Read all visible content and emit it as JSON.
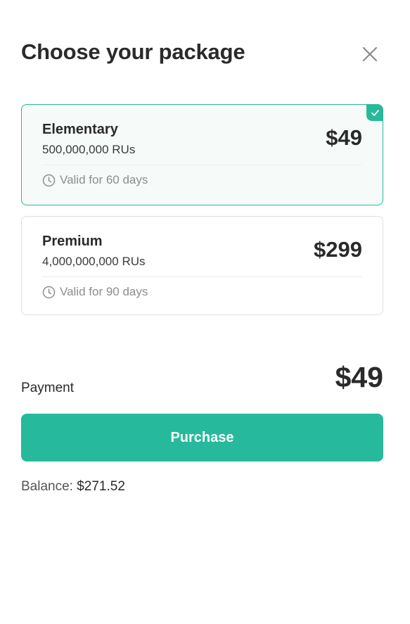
{
  "header": {
    "title": "Choose your package",
    "close_icon": "close-icon"
  },
  "packages": [
    {
      "name": "Elementary",
      "units": "500,000,000 RUs",
      "price": "$49",
      "validity": "Valid for 60 days",
      "selected": true
    },
    {
      "name": "Premium",
      "units": "4,000,000,000 RUs",
      "price": "$299",
      "validity": "Valid for 90 days",
      "selected": false
    }
  ],
  "payment": {
    "label": "Payment",
    "amount": "$49"
  },
  "purchase": {
    "label": "Purchase"
  },
  "balance": {
    "label": "Balance:",
    "value": "$271.52"
  },
  "colors": {
    "accent": "#27b99b",
    "selected_bg": "#f6fbfa",
    "text": "#2a2a2a",
    "muted": "#8d8d8d",
    "border": "#dedede"
  },
  "icons": {
    "close": "close-icon",
    "check": "check-icon",
    "clock": "clock-icon"
  }
}
